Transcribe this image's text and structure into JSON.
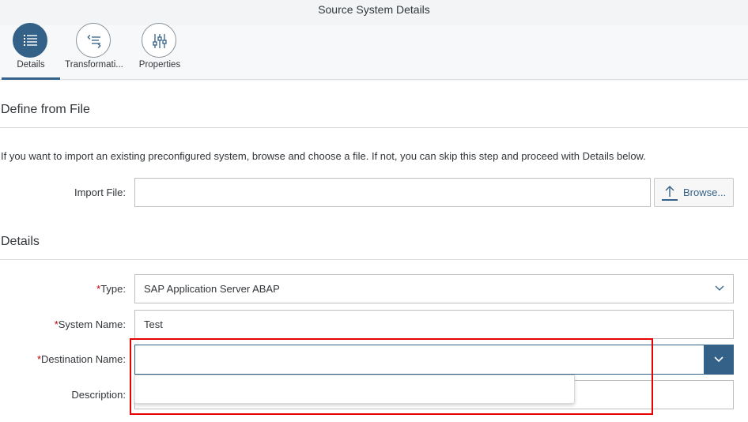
{
  "window": {
    "title": "Source System Details"
  },
  "tabs": [
    {
      "label": "Details",
      "icon": "list-icon",
      "selected": true
    },
    {
      "label": "Transformati...",
      "icon": "transformation-icon",
      "selected": false
    },
    {
      "label": "Properties",
      "icon": "sliders-icon",
      "selected": false
    }
  ],
  "define_from_file": {
    "title": "Define from File",
    "info": "If you want to import an existing preconfigured system, browse and choose a file. If not, you can skip this step and proceed with Details below.",
    "import_file_label": "Import File:",
    "import_file_value": "",
    "browse_label": "Browse...",
    "browse_icon": "upload-icon"
  },
  "details": {
    "title": "Details",
    "required_marker": "*",
    "type_label": "Type:",
    "type_value": "SAP Application Server ABAP",
    "system_name_label": "System Name:",
    "system_name_value": "Test",
    "destination_name_label": "Destination Name:",
    "destination_name_value": "",
    "description_label": "Description:",
    "description_value": ""
  },
  "colors": {
    "accent": "#346187",
    "required": "#bb0000",
    "highlight": "#e60000"
  }
}
